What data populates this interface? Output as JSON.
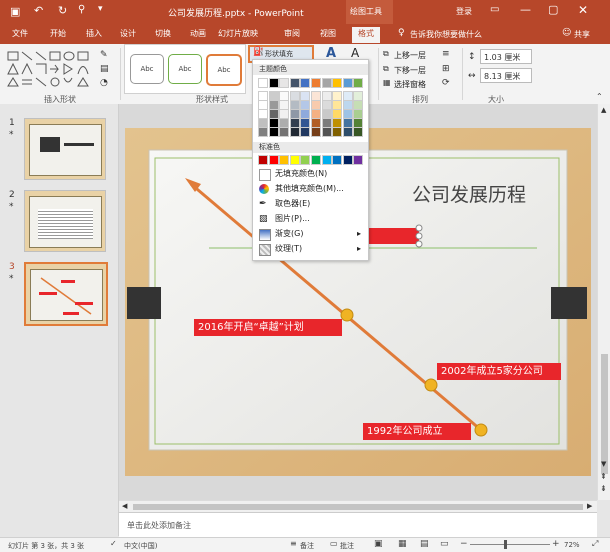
{
  "window": {
    "title": "公司发展历程.pptx - PowerPoint",
    "context_tool": "绘图工具",
    "sign_in": "登录",
    "share": "共享",
    "accent": "#b7472a"
  },
  "menu": {
    "tabs": [
      "文件",
      "开始",
      "插入",
      "设计",
      "切换",
      "动画",
      "幻灯片放映",
      "审阅",
      "视图",
      "格式"
    ],
    "active_tab": "格式",
    "tell_me": "告诉我你想要做什么"
  },
  "ribbon": {
    "insert_shapes_label": "插入形状",
    "shape_styles_label": "形状样式",
    "style_sample": "Abc",
    "fill_button": "形状填充",
    "text_a": "A",
    "arrange_label": "排列",
    "bring_forward": "上移一层",
    "send_backward": "下移一层",
    "selection_pane": "选择窗格",
    "size_label": "大小",
    "height": "1.03 厘米",
    "width": "8.13 厘米"
  },
  "callout": "单击",
  "fill_menu": {
    "theme_colors_header": "主题颜色",
    "standard_colors_header": "标准色",
    "no_fill": "无填充颜色(N)",
    "more_colors": "其他填充颜色(M)...",
    "eyedropper": "取色器(E)",
    "picture": "图片(P)...",
    "gradient": "渐变(G)",
    "texture": "纹理(T)",
    "theme_top": [
      "#ffffff",
      "#000000",
      "#e7e6e6",
      "#44546a",
      "#4472c4",
      "#ed7d31",
      "#a5a5a5",
      "#ffc000",
      "#5b9bd5",
      "#70ad47"
    ],
    "standard": [
      "#c00000",
      "#ff0000",
      "#ffc000",
      "#ffff00",
      "#92d050",
      "#00b050",
      "#00b0f0",
      "#0070c0",
      "#002060",
      "#7030a0"
    ]
  },
  "slides": {
    "numbers": [
      "1",
      "2",
      "3"
    ],
    "selected": "3"
  },
  "slide": {
    "title": "公司发展历程",
    "labels": [
      "2016年开启“卓越”计划",
      "2002年成立5家分公司",
      "1992年公司成立"
    ],
    "label_color": "#e8262b",
    "line_color": "#e07b39",
    "dot_color": "#f0b323"
  },
  "notes_placeholder": "单击此处添加备注",
  "status": {
    "slide_info": "幻灯片 第 3 张，共 3 张",
    "language": "中文(中国)",
    "notes": "备注",
    "comments": "批注",
    "zoom": "72%"
  }
}
